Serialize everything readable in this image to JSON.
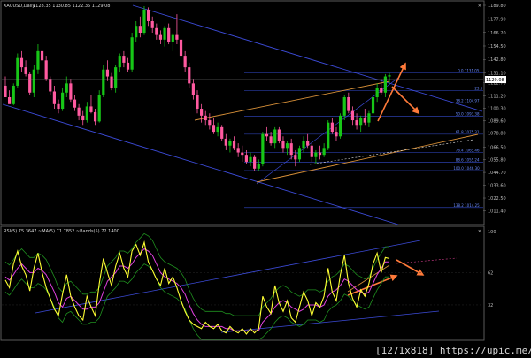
{
  "window": {
    "title": "XAUUSD,Daily",
    "ohlc": "1128.35 1130.85 1122.35 1129.08"
  },
  "rsi_panel": {
    "header": "RSI(5) 75.3647   ~MA(5) 71.7852   ~Bands(5) 72.1400",
    "axis_labels": [
      "100",
      "62",
      "32"
    ]
  },
  "watermark": "[1271x818] https://upic.me/",
  "colors": {
    "bull": "#17c617",
    "bear": "#ff5aa0",
    "channel": "#3c4bd8",
    "fib": "#2b3ea8",
    "trend_orange": "#d89038",
    "arrow": "#ff7a3a",
    "rsi": "#ffff33",
    "rsi_ma": "#e040e0",
    "bands": "#1f8f1f"
  },
  "chart_data": [
    {
      "type": "candlestick",
      "title": "XAUUSD,Daily",
      "ylim": [
        1004.1,
        1189.8
      ],
      "y_ticks": [
        "1189.80",
        "1177.90",
        "1166.20",
        "1154.50",
        "1142.80",
        "1131.10",
        "1122.70",
        "1111.20",
        "1100.30",
        "1089.60",
        "1078.80",
        "1066.50",
        "1055.80",
        "1044.70",
        "1033.60",
        "1022.50",
        "1011.40"
      ],
      "current_price_label": "1129.08",
      "fib_levels": [
        {
          "label": "0.0  1131.05",
          "value": 1131.05
        },
        {
          "label": "23.6",
          "value": 1115.7
        },
        {
          "label": "38.2  1104.97",
          "value": 1104.97
        },
        {
          "label": "50.0  1093.38",
          "value": 1093.38
        },
        {
          "label": "61.8  1075.31",
          "value": 1077.9
        },
        {
          "label": "76.4  1065.46",
          "value": 1062.0
        },
        {
          "label": "88.6  1055.24",
          "value": 1053.5
        },
        {
          "label": "100.0  1046.30",
          "value": 1046.3
        },
        {
          "label": "138.2  1014.25",
          "value": 1014.25
        }
      ],
      "candles": [
        [
          1120,
          1128,
          1116,
          1110
        ],
        [
          1110,
          1116,
          1107,
          1104
        ],
        [
          1104,
          1122,
          1103,
          1120
        ],
        [
          1120,
          1148,
          1118,
          1144
        ],
        [
          1144,
          1150,
          1132,
          1136
        ],
        [
          1136,
          1142,
          1128,
          1130
        ],
        [
          1130,
          1132,
          1112,
          1114
        ],
        [
          1114,
          1138,
          1110,
          1134
        ],
        [
          1134,
          1156,
          1130,
          1150
        ],
        [
          1150,
          1152,
          1140,
          1142
        ],
        [
          1142,
          1146,
          1124,
          1126
        ],
        [
          1126,
          1128,
          1112,
          1115
        ],
        [
          1115,
          1120,
          1100,
          1104
        ],
        [
          1104,
          1108,
          1096,
          1100
        ],
        [
          1100,
          1118,
          1098,
          1114
        ],
        [
          1114,
          1128,
          1110,
          1122
        ],
        [
          1122,
          1126,
          1106,
          1108
        ],
        [
          1108,
          1112,
          1098,
          1101
        ],
        [
          1101,
          1104,
          1090,
          1094
        ],
        [
          1094,
          1098,
          1086,
          1090
        ],
        [
          1090,
          1106,
          1088,
          1102
        ],
        [
          1102,
          1112,
          1096,
          1097
        ],
        [
          1097,
          1100,
          1086,
          1089
        ],
        [
          1089,
          1116,
          1088,
          1112
        ],
        [
          1112,
          1138,
          1110,
          1134
        ],
        [
          1134,
          1142,
          1124,
          1128
        ],
        [
          1128,
          1131,
          1116,
          1118
        ],
        [
          1118,
          1138,
          1114,
          1136
        ],
        [
          1136,
          1148,
          1132,
          1146
        ],
        [
          1146,
          1150,
          1136,
          1140
        ],
        [
          1140,
          1144,
          1132,
          1134
        ],
        [
          1134,
          1166,
          1132,
          1162
        ],
        [
          1162,
          1176,
          1158,
          1172
        ],
        [
          1172,
          1180,
          1162,
          1166
        ],
        [
          1166,
          1189,
          1164,
          1186
        ],
        [
          1186,
          1188,
          1172,
          1176
        ],
        [
          1176,
          1180,
          1166,
          1170
        ],
        [
          1170,
          1174,
          1160,
          1164
        ],
        [
          1164,
          1168,
          1156,
          1160
        ],
        [
          1160,
          1172,
          1154,
          1170
        ],
        [
          1170,
          1174,
          1156,
          1158
        ],
        [
          1158,
          1166,
          1150,
          1164
        ],
        [
          1164,
          1182,
          1156,
          1160
        ],
        [
          1160,
          1164,
          1142,
          1146
        ],
        [
          1146,
          1150,
          1132,
          1136
        ],
        [
          1136,
          1140,
          1118,
          1122
        ],
        [
          1122,
          1126,
          1108,
          1112
        ],
        [
          1112,
          1116,
          1096,
          1100
        ],
        [
          1100,
          1104,
          1088,
          1094
        ],
        [
          1094,
          1098,
          1086,
          1090
        ],
        [
          1090,
          1096,
          1082,
          1086
        ],
        [
          1086,
          1092,
          1078,
          1080
        ],
        [
          1080,
          1088,
          1076,
          1084
        ],
        [
          1084,
          1086,
          1072,
          1074
        ],
        [
          1074,
          1078,
          1064,
          1068
        ],
        [
          1068,
          1074,
          1062,
          1072
        ],
        [
          1072,
          1076,
          1064,
          1066
        ],
        [
          1066,
          1070,
          1058,
          1062
        ],
        [
          1062,
          1068,
          1054,
          1060
        ],
        [
          1060,
          1064,
          1052,
          1054
        ],
        [
          1054,
          1062,
          1050,
          1058
        ],
        [
          1058,
          1060,
          1046,
          1048
        ],
        [
          1048,
          1056,
          1046,
          1052
        ],
        [
          1052,
          1080,
          1050,
          1078
        ],
        [
          1078,
          1084,
          1072,
          1076
        ],
        [
          1076,
          1080,
          1068,
          1070
        ],
        [
          1070,
          1084,
          1066,
          1082
        ],
        [
          1082,
          1084,
          1070,
          1072
        ],
        [
          1072,
          1076,
          1062,
          1066
        ],
        [
          1066,
          1072,
          1060,
          1070
        ],
        [
          1070,
          1074,
          1056,
          1060
        ],
        [
          1060,
          1064,
          1050,
          1056
        ],
        [
          1056,
          1068,
          1054,
          1066
        ],
        [
          1066,
          1076,
          1062,
          1072
        ],
        [
          1072,
          1078,
          1066,
          1068
        ],
        [
          1068,
          1070,
          1054,
          1058
        ],
        [
          1058,
          1064,
          1052,
          1062
        ],
        [
          1062,
          1068,
          1056,
          1060
        ],
        [
          1060,
          1070,
          1058,
          1066
        ],
        [
          1066,
          1090,
          1064,
          1088
        ],
        [
          1088,
          1092,
          1078,
          1080
        ],
        [
          1080,
          1084,
          1072,
          1076
        ],
        [
          1076,
          1096,
          1074,
          1094
        ],
        [
          1094,
          1112,
          1090,
          1110
        ],
        [
          1110,
          1114,
          1096,
          1098
        ],
        [
          1098,
          1102,
          1086,
          1090
        ],
        [
          1090,
          1096,
          1082,
          1086
        ],
        [
          1086,
          1094,
          1080,
          1092
        ],
        [
          1092,
          1100,
          1086,
          1088
        ],
        [
          1088,
          1098,
          1084,
          1096
        ],
        [
          1096,
          1112,
          1094,
          1110
        ],
        [
          1110,
          1122,
          1106,
          1118
        ],
        [
          1118,
          1126,
          1112,
          1114
        ],
        [
          1114,
          1130,
          1110,
          1128
        ],
        [
          1128,
          1131,
          1122,
          1129
        ]
      ]
    },
    {
      "type": "line",
      "title": "RSI(5) 75.3647   ~MA(5) 71.7852   ~Bands(5) 72.1400",
      "ylim": [
        0,
        100
      ],
      "series": [
        {
          "name": "RSI(5)",
          "values": [
            55,
            48,
            70,
            82,
            68,
            60,
            45,
            66,
            80,
            62,
            48,
            38,
            28,
            22,
            42,
            60,
            40,
            30,
            22,
            18,
            40,
            30,
            22,
            52,
            75,
            62,
            50,
            68,
            80,
            66,
            58,
            82,
            88,
            78,
            90,
            72,
            64,
            56,
            50,
            66,
            52,
            58,
            48,
            36,
            26,
            18,
            14,
            12,
            10,
            16,
            12,
            10,
            14,
            8,
            6,
            12,
            8,
            6,
            10,
            5,
            10,
            6,
            10,
            40,
            30,
            24,
            50,
            34,
            26,
            36,
            20,
            16,
            30,
            44,
            36,
            22,
            34,
            30,
            40,
            66,
            44,
            36,
            60,
            78,
            52,
            38,
            30,
            46,
            40,
            52,
            70,
            80,
            62,
            76,
            75
          ]
        },
        {
          "name": "MA(5)",
          "values": [
            58,
            55,
            60,
            66,
            70,
            66,
            62,
            62,
            66,
            64,
            60,
            52,
            44,
            34,
            30,
            38,
            40,
            36,
            32,
            28,
            28,
            30,
            30,
            34,
            44,
            54,
            58,
            62,
            68,
            68,
            66,
            70,
            76,
            80,
            84,
            82,
            78,
            70,
            62,
            58,
            56,
            54,
            52,
            48,
            42,
            32,
            24,
            18,
            14,
            12,
            12,
            12,
            12,
            12,
            10,
            10,
            8,
            8,
            8,
            8,
            8,
            8,
            8,
            16,
            20,
            24,
            30,
            34,
            36,
            34,
            30,
            28,
            26,
            28,
            32,
            32,
            32,
            30,
            32,
            40,
            44,
            46,
            50,
            56,
            54,
            50,
            46,
            44,
            42,
            44,
            52,
            60,
            66,
            72,
            72
          ]
        }
      ]
    }
  ]
}
